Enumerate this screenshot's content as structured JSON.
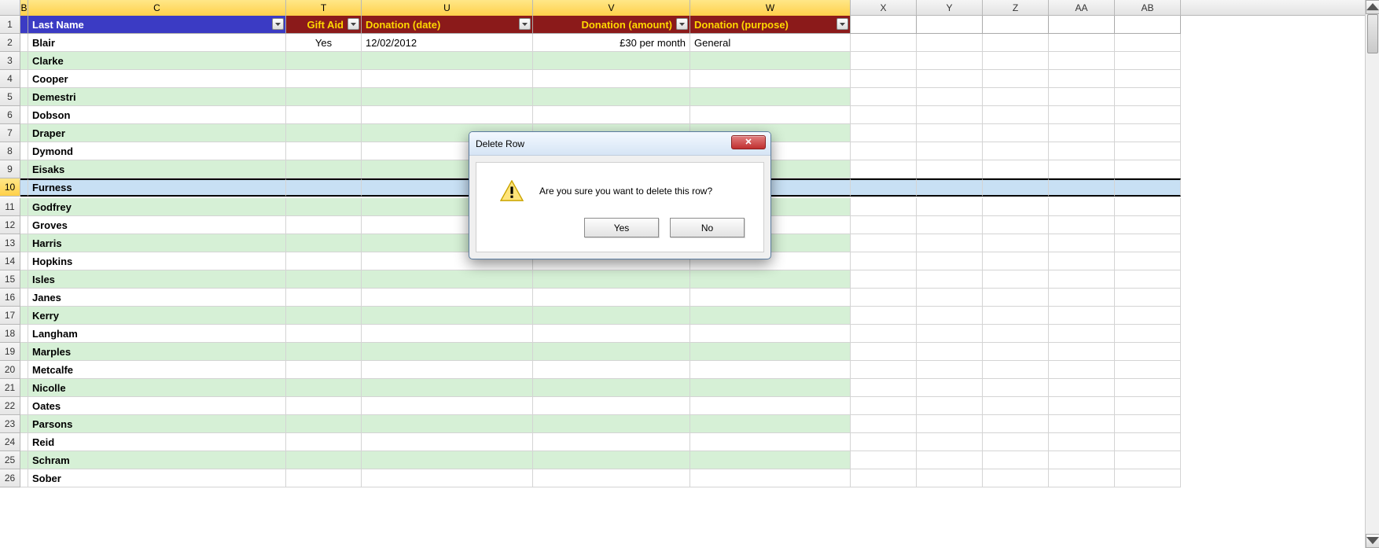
{
  "columns": {
    "B": "B",
    "C": "C",
    "T": "T",
    "U": "U",
    "V": "V",
    "W": "W",
    "X": "X",
    "Y": "Y",
    "Z": "Z",
    "AA": "AA",
    "AB": "AB"
  },
  "headers": {
    "last_name": "Last Name",
    "gift_aid": "Gift Aid",
    "donation_date": "Donation (date)",
    "donation_amount": "Donation (amount)",
    "donation_purpose": "Donation (purpose)"
  },
  "rows": [
    {
      "n": 1,
      "header": true
    },
    {
      "n": 2,
      "last_name": "Blair",
      "gift_aid": "Yes",
      "donation_date": "12/02/2012",
      "donation_amount": "£30 per month",
      "donation_purpose": "General"
    },
    {
      "n": 3,
      "last_name": "Clarke"
    },
    {
      "n": 4,
      "last_name": "Cooper"
    },
    {
      "n": 5,
      "last_name": "Demestri"
    },
    {
      "n": 6,
      "last_name": "Dobson"
    },
    {
      "n": 7,
      "last_name": "Draper"
    },
    {
      "n": 8,
      "last_name": "Dymond"
    },
    {
      "n": 9,
      "last_name": "Eisaks"
    },
    {
      "n": 10,
      "last_name": "Furness",
      "selected": true
    },
    {
      "n": 11,
      "last_name": "Godfrey"
    },
    {
      "n": 12,
      "last_name": "Groves"
    },
    {
      "n": 13,
      "last_name": "Harris"
    },
    {
      "n": 14,
      "last_name": "Hopkins"
    },
    {
      "n": 15,
      "last_name": "Isles"
    },
    {
      "n": 16,
      "last_name": "Janes"
    },
    {
      "n": 17,
      "last_name": "Kerry"
    },
    {
      "n": 18,
      "last_name": "Langham"
    },
    {
      "n": 19,
      "last_name": "Marples"
    },
    {
      "n": 20,
      "last_name": "Metcalfe"
    },
    {
      "n": 21,
      "last_name": "Nicolle"
    },
    {
      "n": 22,
      "last_name": "Oates"
    },
    {
      "n": 23,
      "last_name": "Parsons"
    },
    {
      "n": 24,
      "last_name": "Reid"
    },
    {
      "n": 25,
      "last_name": "Schram"
    },
    {
      "n": 26,
      "last_name": "Sober"
    }
  ],
  "dialog": {
    "title": "Delete Row",
    "message": "Are you sure you want to delete this row?",
    "yes": "Yes",
    "no": "No"
  }
}
